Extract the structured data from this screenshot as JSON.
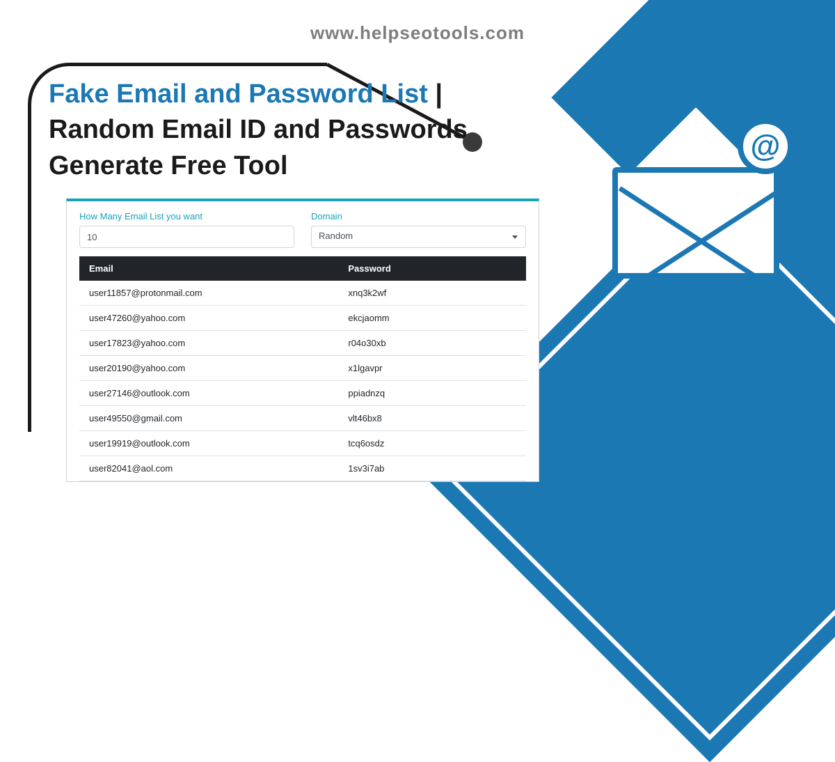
{
  "site_url": "www.helpseotools.com",
  "title": {
    "highlight": "Fake Email and Password List",
    "separator": " | ",
    "line2a": "Random Email ID and Passwords",
    "line2b": "Generate Free Tool"
  },
  "form": {
    "count_label": "How Many Email List you want",
    "count_value": "10",
    "domain_label": "Domain",
    "domain_value": "Random"
  },
  "table": {
    "headers": {
      "email": "Email",
      "password": "Password"
    },
    "rows": [
      {
        "email": "user11857@protonmail.com",
        "password": "xnq3k2wf"
      },
      {
        "email": "user47260@yahoo.com",
        "password": "ekcjaomm"
      },
      {
        "email": "user17823@yahoo.com",
        "password": "r04o30xb"
      },
      {
        "email": "user20190@yahoo.com",
        "password": "x1lgavpr"
      },
      {
        "email": "user27146@outlook.com",
        "password": "ppiadnzq"
      },
      {
        "email": "user49550@gmail.com",
        "password": "vlt46bx8"
      },
      {
        "email": "user19919@outlook.com",
        "password": "tcq6osdz"
      },
      {
        "email": "user82041@aol.com",
        "password": "1sv3i7ab"
      }
    ]
  },
  "icons": {
    "at": "@"
  }
}
